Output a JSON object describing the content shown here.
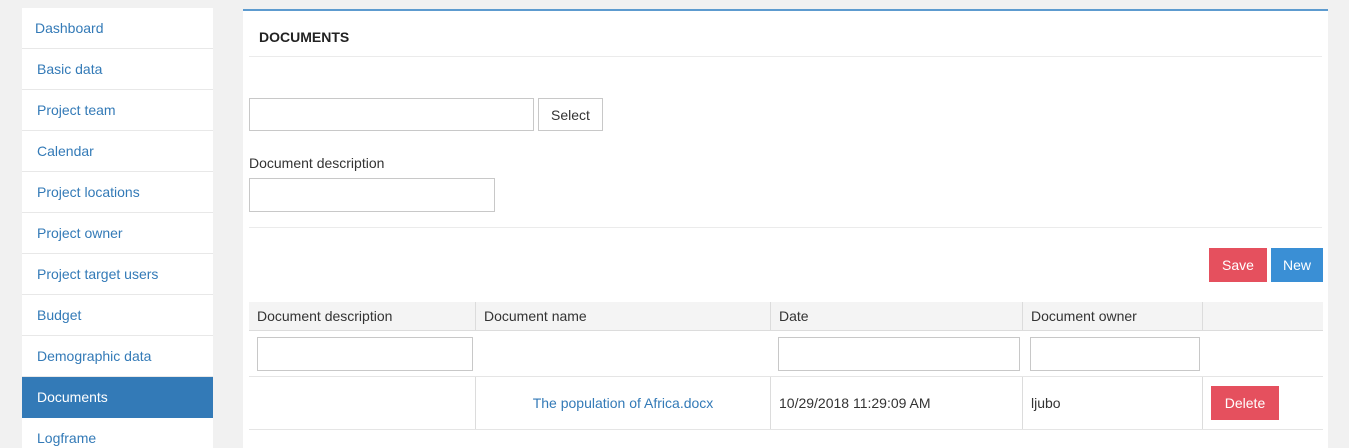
{
  "sidebar": {
    "items": [
      {
        "label": "Dashboard"
      },
      {
        "label": "Basic data"
      },
      {
        "label": "Project team"
      },
      {
        "label": "Calendar"
      },
      {
        "label": "Project locations"
      },
      {
        "label": "Project owner"
      },
      {
        "label": "Project target users"
      },
      {
        "label": "Budget"
      },
      {
        "label": "Demographic data"
      },
      {
        "label": "Documents"
      },
      {
        "label": "Logframe"
      }
    ],
    "active": "Documents"
  },
  "panel": {
    "title": "DOCUMENTS",
    "file_input_value": "",
    "select_label": "Select",
    "description_label": "Document description",
    "description_value": "",
    "save_label": "Save",
    "new_label": "New"
  },
  "grid": {
    "columns": [
      "Document description",
      "Document name",
      "Date",
      "Document owner",
      ""
    ],
    "filters": {
      "description": "",
      "date": "",
      "owner": ""
    },
    "rows": [
      {
        "description": "",
        "name": "The population of Africa.docx",
        "date": "10/29/2018 11:29:09 AM",
        "owner": "ljubo",
        "action": "Delete"
      }
    ]
  },
  "colors": {
    "primary": "#337ab7",
    "danger": "#e5505e",
    "info": "#3a8fd5"
  }
}
